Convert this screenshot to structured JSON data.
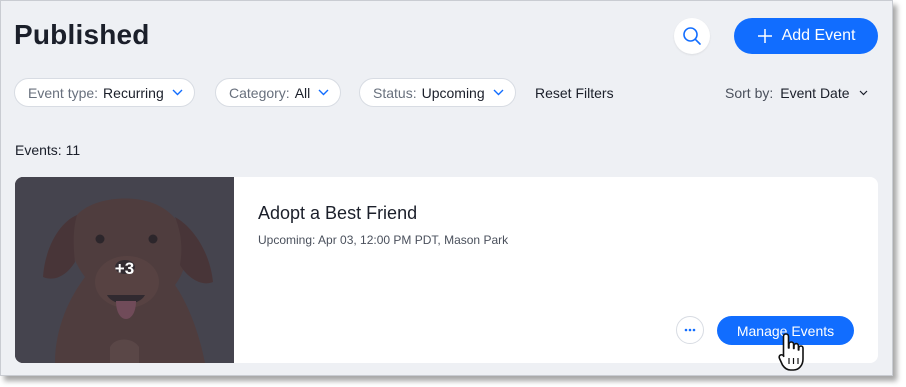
{
  "page": {
    "title": "Published"
  },
  "header": {
    "search_icon": "search-icon",
    "add_event_label": "Add Event",
    "add_event_icon": "plus-icon"
  },
  "filters": [
    {
      "key": "Event type:",
      "value": "Recurring"
    },
    {
      "key": "Category:",
      "value": "All"
    },
    {
      "key": "Status:",
      "value": "Upcoming"
    }
  ],
  "reset_filters_label": "Reset Filters",
  "sort": {
    "label": "Sort by:",
    "value": "Event Date"
  },
  "events_count": "Events: 11",
  "event": {
    "name": "Adopt a Best Friend",
    "meta": "Upcoming: Apr 03, 12:00 PM PDT, Mason Park",
    "image_overlay": "+3",
    "more_label": "···",
    "manage_label": "Manage Events"
  },
  "colors": {
    "accent": "#116dff",
    "background": "#eef0f4",
    "card": "#ffffff",
    "text": "#1b1f2a"
  }
}
